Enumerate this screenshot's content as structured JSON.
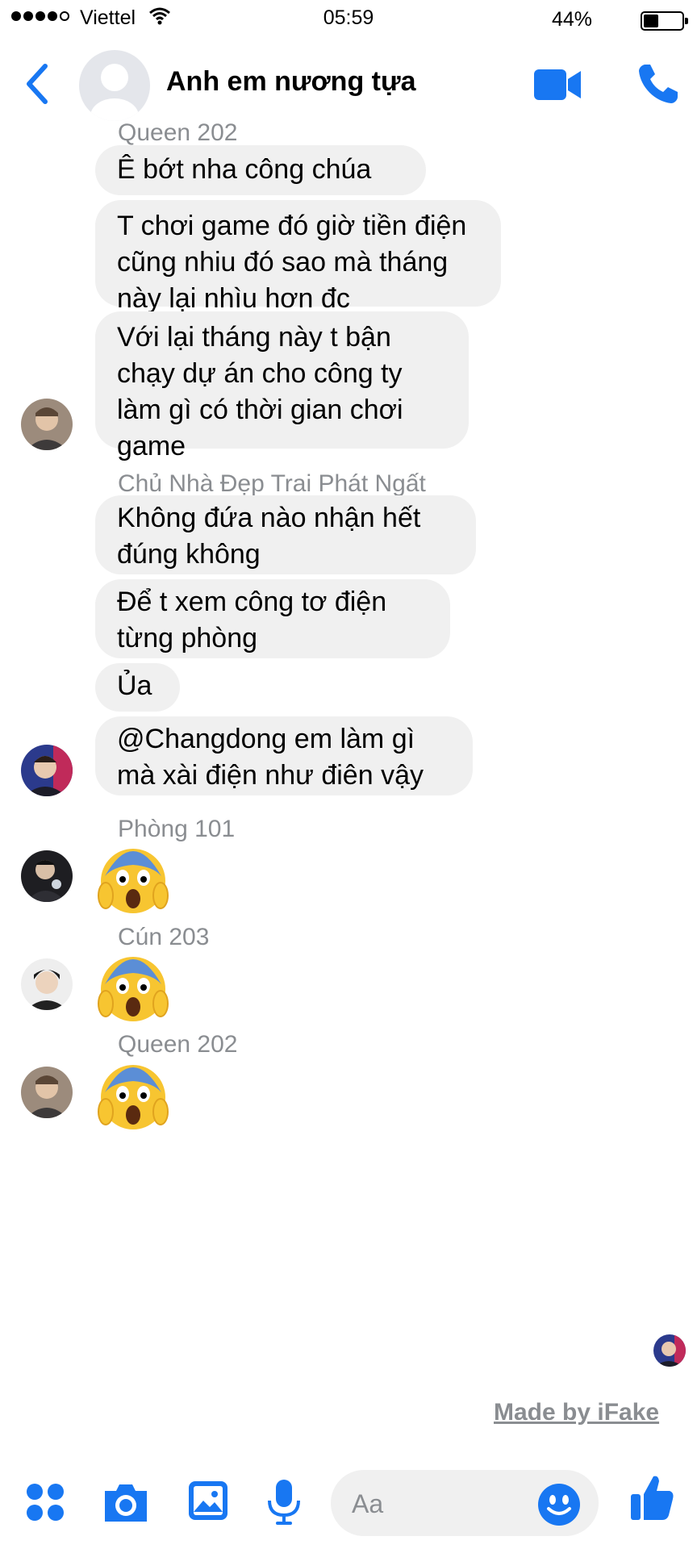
{
  "status_bar": {
    "carrier": "Viettel",
    "time": "05:59",
    "battery": "44%",
    "battery_level": 0.44
  },
  "header": {
    "title": "Anh em nương tựa"
  },
  "colors": {
    "accent": "#1877f2",
    "bubble_bg": "#f0f0f0",
    "sender_gray": "#8a8d91"
  },
  "messages": [
    {
      "sender": "Queen 202",
      "bubbles": [
        "Ê bớt nha công chúa",
        "T chơi game đó giờ tiền điện cũng nhiu đó sao mà tháng này lại nhìu hơn đc",
        "Với lại tháng này t bận chạy dự án cho công ty làm gì có thời gian chơi game"
      ]
    },
    {
      "sender": "Chủ Nhà Đẹp Trai Phát Ngất",
      "bubbles": [
        "Không đứa nào nhận hết đúng không",
        "Để t xem công tơ điện từng phòng",
        "Ủa",
        "@Changdong em làm gì mà xài điện như điên vậy"
      ]
    },
    {
      "sender": "Phòng 101",
      "emoji": "face-screaming-in-fear"
    },
    {
      "sender": "Cún 203",
      "emoji": "face-screaming-in-fear"
    },
    {
      "sender": "Queen 202",
      "emoji": "face-screaming-in-fear"
    }
  ],
  "watermark": "Made by iFake",
  "composer": {
    "placeholder": "Aa",
    "icons": [
      "apps-icon",
      "camera-icon",
      "gallery-icon",
      "microphone-icon",
      "emoji-icon",
      "like-icon"
    ]
  }
}
